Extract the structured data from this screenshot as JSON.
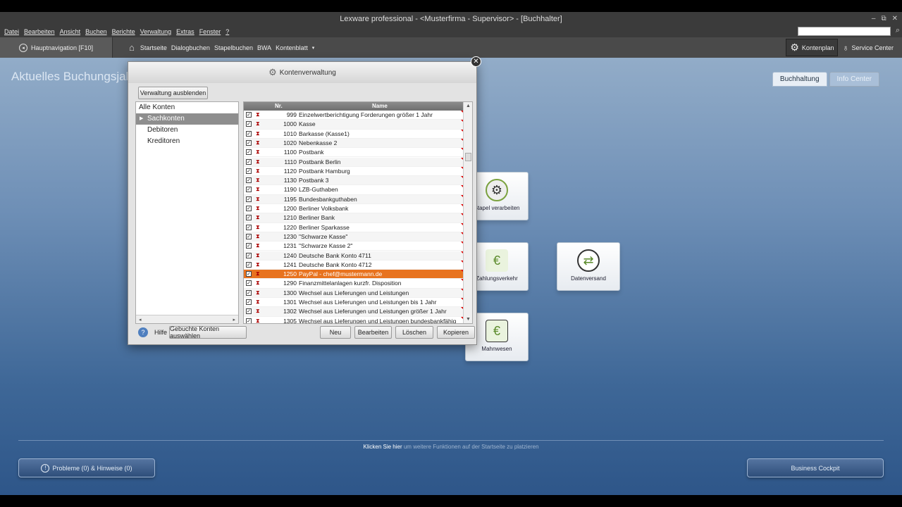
{
  "app": {
    "title": "Lexware professional - <Musterfirma - Supervisor> - [Buchhalter]",
    "window_controls": [
      "–",
      "⧉",
      "✕"
    ]
  },
  "menu": [
    "Datei",
    "Bearbeiten",
    "Ansicht",
    "Buchen",
    "Berichte",
    "Verwaltung",
    "Extras",
    "Fenster",
    "?"
  ],
  "navbar": {
    "hauptnav_label": "Hauptnavigation [F10]",
    "quick_links": [
      "Startseite",
      "Dialogbuchen",
      "Stapelbuchen",
      "BWA",
      "Kontenblatt"
    ],
    "kontenplan_label": "Kontenplan",
    "service_label": "Service Center"
  },
  "page": {
    "heading": "Aktuelles Buchungsjah",
    "tabs": [
      "Buchhaltung",
      "Info Center"
    ]
  },
  "tiles": {
    "stapel": "Stapel verarbeiten",
    "zahlung": "Zahlungsverkehr",
    "datenversand": "Datenversand",
    "mahnwesen": "Mahnwesen"
  },
  "hint": {
    "link": "Klicken Sie hier",
    "rest": "um weitere Funktionen auf der Startseite zu platzieren"
  },
  "bottom": {
    "problems": "Probleme (0) & Hinweise (0)",
    "cockpit": "Business Cockpit"
  },
  "dialog": {
    "title": "Kontenverwaltung",
    "hide_button": "Verwaltung ausblenden",
    "tree": {
      "root": "Alle Konten",
      "items": [
        "Sachkonten",
        "Debitoren",
        "Kreditoren"
      ]
    },
    "columns": {
      "nr": "Nr.",
      "name": "Name"
    },
    "rows": [
      {
        "nr": "999",
        "name": "Einzelwertberichtigung Forderungen größer 1 Jahr"
      },
      {
        "nr": "1000",
        "name": "Kasse"
      },
      {
        "nr": "1010",
        "name": "Barkasse (Kasse1)"
      },
      {
        "nr": "1020",
        "name": "Nebenkasse 2"
      },
      {
        "nr": "1100",
        "name": "Postbank"
      },
      {
        "nr": "1110",
        "name": "Postbank Berlin"
      },
      {
        "nr": "1120",
        "name": "Postbank Hamburg"
      },
      {
        "nr": "1130",
        "name": "Postbank 3"
      },
      {
        "nr": "1190",
        "name": "LZB-Guthaben"
      },
      {
        "nr": "1195",
        "name": "Bundesbankguthaben"
      },
      {
        "nr": "1200",
        "name": "Berliner Volksbank"
      },
      {
        "nr": "1210",
        "name": "Berliner Bank"
      },
      {
        "nr": "1220",
        "name": "Berliner Sparkasse"
      },
      {
        "nr": "1230",
        "name": "\"Schwarze Kasse\""
      },
      {
        "nr": "1231",
        "name": "\"Schwarze Kasse 2\""
      },
      {
        "nr": "1240",
        "name": "Deutsche Bank Konto 4711"
      },
      {
        "nr": "1241",
        "name": "Deutsche Bank Konto 4712"
      },
      {
        "nr": "1250",
        "name": "PayPal - chef@mustermann.de"
      },
      {
        "nr": "1290",
        "name": "Finanzmittelanlagen kurzfr. Disposition"
      },
      {
        "nr": "1300",
        "name": "Wechsel aus Lieferungen und Leistungen"
      },
      {
        "nr": "1301",
        "name": "Wechsel aus Lieferungen und Leistungen bis 1 Jahr"
      },
      {
        "nr": "1302",
        "name": "Wechsel aus Lieferungen und Leistungen größer 1 Jahr"
      },
      {
        "nr": "1305",
        "name": "Wechsel aus Lieferungen und Leistungen bundesbankfähig"
      }
    ],
    "selected_row": 17,
    "help_label": "Hilfe",
    "booked_button": "Gebuchte Konten auswählen",
    "buttons": {
      "neu": "Neu",
      "bearbeiten": "Bearbeiten",
      "loeschen": "Löschen",
      "kopieren": "Kopieren"
    }
  },
  "colors": {
    "selection": "#e8731f",
    "titlebar": "#3b3b3b",
    "background_top": "#92acc8",
    "background_bottom": "#2e5689"
  }
}
